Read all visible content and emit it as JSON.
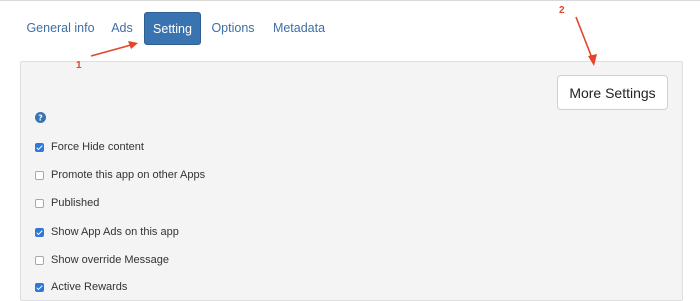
{
  "tabs": [
    {
      "label": "General info",
      "active": false
    },
    {
      "label": "Ads",
      "active": false
    },
    {
      "label": "Setting",
      "active": true
    },
    {
      "label": "Options",
      "active": false
    },
    {
      "label": "Metadata",
      "active": false
    }
  ],
  "panel": {
    "more_settings_label": "More Settings",
    "help_icon": "question-circle-icon",
    "options": [
      {
        "label": "Force Hide content",
        "checked": true
      },
      {
        "label": "Promote this app on other Apps",
        "checked": false
      },
      {
        "label": "Published",
        "checked": false
      },
      {
        "label": "Show App Ads on this app",
        "checked": true
      },
      {
        "label": "Show override Message",
        "checked": false
      },
      {
        "label": "Active Rewards",
        "checked": true
      }
    ]
  },
  "annotations": {
    "marker_1": "1",
    "marker_2": "2",
    "color": "#e2442c"
  },
  "colors": {
    "accent": "#3a74b0",
    "link": "#3e6fa5",
    "checkbox": "#2f78d8"
  }
}
